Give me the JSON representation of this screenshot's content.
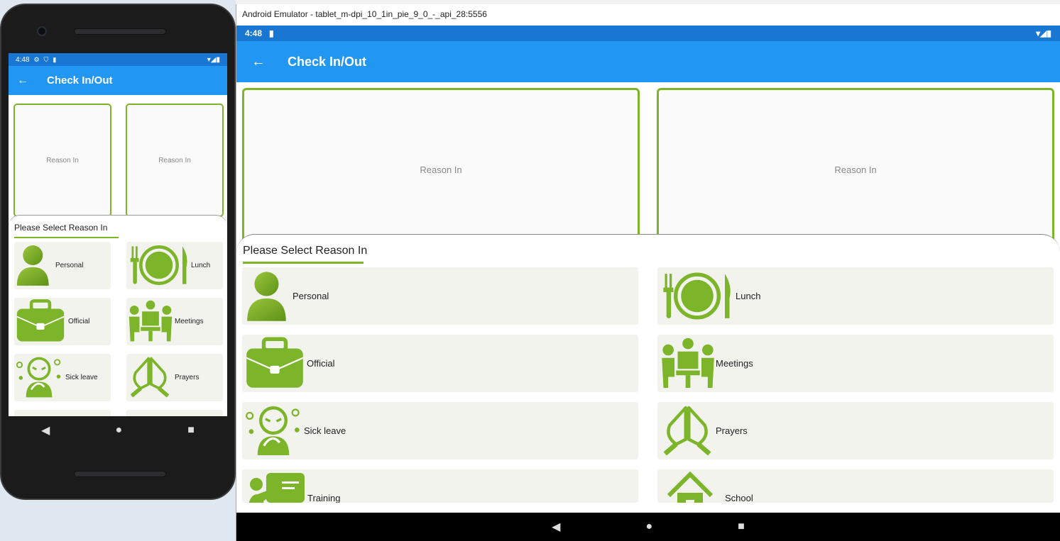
{
  "phone": {
    "status": {
      "time": "4:48",
      "icons": [
        "gear-icon",
        "shield-icon",
        "sd-card-icon"
      ],
      "right_icons": "▾◢▮"
    },
    "appbar": {
      "back_icon": "←",
      "title": "Check In/Out"
    },
    "cards": [
      "Reason In",
      "Reason In"
    ],
    "sheet": {
      "title": "Please Select Reason In"
    },
    "reasons": [
      "Personal",
      "Lunch",
      "Official",
      "Meetings",
      "Sick leave",
      "Prayers"
    ],
    "nav": {
      "back": "◀",
      "home": "●",
      "recents": "■"
    }
  },
  "emulator": {
    "window_title": "Android Emulator - tablet_m-dpi_10_1in_pie_9_0_-_api_28:5556",
    "status": {
      "time": "4:48",
      "right_icons": "▾◢▮"
    },
    "appbar": {
      "back_icon": "←",
      "title": "Check In/Out"
    },
    "cards": [
      "Reason In",
      "Reason In"
    ],
    "sheet": {
      "title": "Please Select Reason In"
    },
    "reasons": [
      "Personal",
      "Lunch",
      "Official",
      "Meetings",
      "Sick leave",
      "Prayers",
      "Training",
      "School"
    ],
    "nav": {
      "back": "◀",
      "home": "●",
      "recents": "■"
    }
  },
  "colors": {
    "accent": "#7cb42a",
    "appbar": "#2196f3",
    "statusbar": "#1976d2",
    "tile": "#f3f3ee"
  }
}
